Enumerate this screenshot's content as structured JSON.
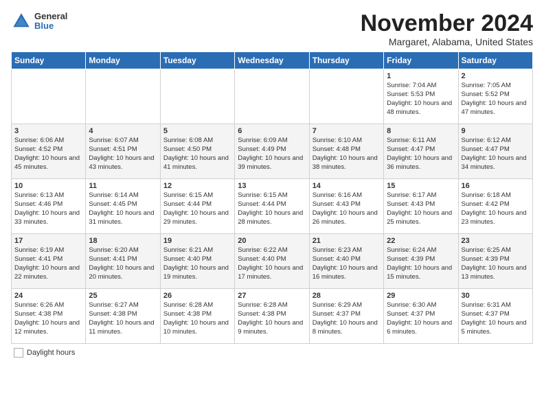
{
  "header": {
    "logo_general": "General",
    "logo_blue": "Blue",
    "title": "November 2024",
    "subtitle": "Margaret, Alabama, United States"
  },
  "calendar": {
    "days_of_week": [
      "Sunday",
      "Monday",
      "Tuesday",
      "Wednesday",
      "Thursday",
      "Friday",
      "Saturday"
    ],
    "weeks": [
      [
        {
          "day": "",
          "info": ""
        },
        {
          "day": "",
          "info": ""
        },
        {
          "day": "",
          "info": ""
        },
        {
          "day": "",
          "info": ""
        },
        {
          "day": "",
          "info": ""
        },
        {
          "day": "1",
          "info": "Sunrise: 7:04 AM\nSunset: 5:53 PM\nDaylight: 10 hours and 48 minutes."
        },
        {
          "day": "2",
          "info": "Sunrise: 7:05 AM\nSunset: 5:52 PM\nDaylight: 10 hours and 47 minutes."
        }
      ],
      [
        {
          "day": "3",
          "info": "Sunrise: 6:06 AM\nSunset: 4:52 PM\nDaylight: 10 hours and 45 minutes."
        },
        {
          "day": "4",
          "info": "Sunrise: 6:07 AM\nSunset: 4:51 PM\nDaylight: 10 hours and 43 minutes."
        },
        {
          "day": "5",
          "info": "Sunrise: 6:08 AM\nSunset: 4:50 PM\nDaylight: 10 hours and 41 minutes."
        },
        {
          "day": "6",
          "info": "Sunrise: 6:09 AM\nSunset: 4:49 PM\nDaylight: 10 hours and 39 minutes."
        },
        {
          "day": "7",
          "info": "Sunrise: 6:10 AM\nSunset: 4:48 PM\nDaylight: 10 hours and 38 minutes."
        },
        {
          "day": "8",
          "info": "Sunrise: 6:11 AM\nSunset: 4:47 PM\nDaylight: 10 hours and 36 minutes."
        },
        {
          "day": "9",
          "info": "Sunrise: 6:12 AM\nSunset: 4:47 PM\nDaylight: 10 hours and 34 minutes."
        }
      ],
      [
        {
          "day": "10",
          "info": "Sunrise: 6:13 AM\nSunset: 4:46 PM\nDaylight: 10 hours and 33 minutes."
        },
        {
          "day": "11",
          "info": "Sunrise: 6:14 AM\nSunset: 4:45 PM\nDaylight: 10 hours and 31 minutes."
        },
        {
          "day": "12",
          "info": "Sunrise: 6:15 AM\nSunset: 4:44 PM\nDaylight: 10 hours and 29 minutes."
        },
        {
          "day": "13",
          "info": "Sunrise: 6:15 AM\nSunset: 4:44 PM\nDaylight: 10 hours and 28 minutes."
        },
        {
          "day": "14",
          "info": "Sunrise: 6:16 AM\nSunset: 4:43 PM\nDaylight: 10 hours and 26 minutes."
        },
        {
          "day": "15",
          "info": "Sunrise: 6:17 AM\nSunset: 4:43 PM\nDaylight: 10 hours and 25 minutes."
        },
        {
          "day": "16",
          "info": "Sunrise: 6:18 AM\nSunset: 4:42 PM\nDaylight: 10 hours and 23 minutes."
        }
      ],
      [
        {
          "day": "17",
          "info": "Sunrise: 6:19 AM\nSunset: 4:41 PM\nDaylight: 10 hours and 22 minutes."
        },
        {
          "day": "18",
          "info": "Sunrise: 6:20 AM\nSunset: 4:41 PM\nDaylight: 10 hours and 20 minutes."
        },
        {
          "day": "19",
          "info": "Sunrise: 6:21 AM\nSunset: 4:40 PM\nDaylight: 10 hours and 19 minutes."
        },
        {
          "day": "20",
          "info": "Sunrise: 6:22 AM\nSunset: 4:40 PM\nDaylight: 10 hours and 17 minutes."
        },
        {
          "day": "21",
          "info": "Sunrise: 6:23 AM\nSunset: 4:40 PM\nDaylight: 10 hours and 16 minutes."
        },
        {
          "day": "22",
          "info": "Sunrise: 6:24 AM\nSunset: 4:39 PM\nDaylight: 10 hours and 15 minutes."
        },
        {
          "day": "23",
          "info": "Sunrise: 6:25 AM\nSunset: 4:39 PM\nDaylight: 10 hours and 13 minutes."
        }
      ],
      [
        {
          "day": "24",
          "info": "Sunrise: 6:26 AM\nSunset: 4:38 PM\nDaylight: 10 hours and 12 minutes."
        },
        {
          "day": "25",
          "info": "Sunrise: 6:27 AM\nSunset: 4:38 PM\nDaylight: 10 hours and 11 minutes."
        },
        {
          "day": "26",
          "info": "Sunrise: 6:28 AM\nSunset: 4:38 PM\nDaylight: 10 hours and 10 minutes."
        },
        {
          "day": "27",
          "info": "Sunrise: 6:28 AM\nSunset: 4:38 PM\nDaylight: 10 hours and 9 minutes."
        },
        {
          "day": "28",
          "info": "Sunrise: 6:29 AM\nSunset: 4:37 PM\nDaylight: 10 hours and 8 minutes."
        },
        {
          "day": "29",
          "info": "Sunrise: 6:30 AM\nSunset: 4:37 PM\nDaylight: 10 hours and 6 minutes."
        },
        {
          "day": "30",
          "info": "Sunrise: 6:31 AM\nSunset: 4:37 PM\nDaylight: 10 hours and 5 minutes."
        }
      ]
    ]
  },
  "legend": {
    "daylight_label": "Daylight hours"
  }
}
